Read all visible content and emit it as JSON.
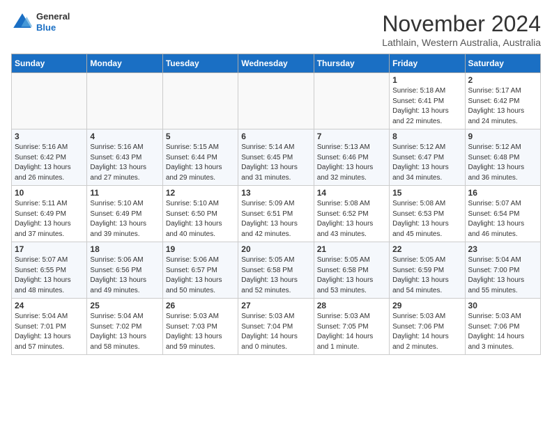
{
  "logo": {
    "general": "General",
    "blue": "Blue"
  },
  "header": {
    "month": "November 2024",
    "location": "Lathlain, Western Australia, Australia"
  },
  "weekdays": [
    "Sunday",
    "Monday",
    "Tuesday",
    "Wednesday",
    "Thursday",
    "Friday",
    "Saturday"
  ],
  "weeks": [
    [
      {
        "day": "",
        "info": ""
      },
      {
        "day": "",
        "info": ""
      },
      {
        "day": "",
        "info": ""
      },
      {
        "day": "",
        "info": ""
      },
      {
        "day": "",
        "info": ""
      },
      {
        "day": "1",
        "info": "Sunrise: 5:18 AM\nSunset: 6:41 PM\nDaylight: 13 hours\nand 22 minutes."
      },
      {
        "day": "2",
        "info": "Sunrise: 5:17 AM\nSunset: 6:42 PM\nDaylight: 13 hours\nand 24 minutes."
      }
    ],
    [
      {
        "day": "3",
        "info": "Sunrise: 5:16 AM\nSunset: 6:42 PM\nDaylight: 13 hours\nand 26 minutes."
      },
      {
        "day": "4",
        "info": "Sunrise: 5:16 AM\nSunset: 6:43 PM\nDaylight: 13 hours\nand 27 minutes."
      },
      {
        "day": "5",
        "info": "Sunrise: 5:15 AM\nSunset: 6:44 PM\nDaylight: 13 hours\nand 29 minutes."
      },
      {
        "day": "6",
        "info": "Sunrise: 5:14 AM\nSunset: 6:45 PM\nDaylight: 13 hours\nand 31 minutes."
      },
      {
        "day": "7",
        "info": "Sunrise: 5:13 AM\nSunset: 6:46 PM\nDaylight: 13 hours\nand 32 minutes."
      },
      {
        "day": "8",
        "info": "Sunrise: 5:12 AM\nSunset: 6:47 PM\nDaylight: 13 hours\nand 34 minutes."
      },
      {
        "day": "9",
        "info": "Sunrise: 5:12 AM\nSunset: 6:48 PM\nDaylight: 13 hours\nand 36 minutes."
      }
    ],
    [
      {
        "day": "10",
        "info": "Sunrise: 5:11 AM\nSunset: 6:49 PM\nDaylight: 13 hours\nand 37 minutes."
      },
      {
        "day": "11",
        "info": "Sunrise: 5:10 AM\nSunset: 6:49 PM\nDaylight: 13 hours\nand 39 minutes."
      },
      {
        "day": "12",
        "info": "Sunrise: 5:10 AM\nSunset: 6:50 PM\nDaylight: 13 hours\nand 40 minutes."
      },
      {
        "day": "13",
        "info": "Sunrise: 5:09 AM\nSunset: 6:51 PM\nDaylight: 13 hours\nand 42 minutes."
      },
      {
        "day": "14",
        "info": "Sunrise: 5:08 AM\nSunset: 6:52 PM\nDaylight: 13 hours\nand 43 minutes."
      },
      {
        "day": "15",
        "info": "Sunrise: 5:08 AM\nSunset: 6:53 PM\nDaylight: 13 hours\nand 45 minutes."
      },
      {
        "day": "16",
        "info": "Sunrise: 5:07 AM\nSunset: 6:54 PM\nDaylight: 13 hours\nand 46 minutes."
      }
    ],
    [
      {
        "day": "17",
        "info": "Sunrise: 5:07 AM\nSunset: 6:55 PM\nDaylight: 13 hours\nand 48 minutes."
      },
      {
        "day": "18",
        "info": "Sunrise: 5:06 AM\nSunset: 6:56 PM\nDaylight: 13 hours\nand 49 minutes."
      },
      {
        "day": "19",
        "info": "Sunrise: 5:06 AM\nSunset: 6:57 PM\nDaylight: 13 hours\nand 50 minutes."
      },
      {
        "day": "20",
        "info": "Sunrise: 5:05 AM\nSunset: 6:58 PM\nDaylight: 13 hours\nand 52 minutes."
      },
      {
        "day": "21",
        "info": "Sunrise: 5:05 AM\nSunset: 6:58 PM\nDaylight: 13 hours\nand 53 minutes."
      },
      {
        "day": "22",
        "info": "Sunrise: 5:05 AM\nSunset: 6:59 PM\nDaylight: 13 hours\nand 54 minutes."
      },
      {
        "day": "23",
        "info": "Sunrise: 5:04 AM\nSunset: 7:00 PM\nDaylight: 13 hours\nand 55 minutes."
      }
    ],
    [
      {
        "day": "24",
        "info": "Sunrise: 5:04 AM\nSunset: 7:01 PM\nDaylight: 13 hours\nand 57 minutes."
      },
      {
        "day": "25",
        "info": "Sunrise: 5:04 AM\nSunset: 7:02 PM\nDaylight: 13 hours\nand 58 minutes."
      },
      {
        "day": "26",
        "info": "Sunrise: 5:03 AM\nSunset: 7:03 PM\nDaylight: 13 hours\nand 59 minutes."
      },
      {
        "day": "27",
        "info": "Sunrise: 5:03 AM\nSunset: 7:04 PM\nDaylight: 14 hours\nand 0 minutes."
      },
      {
        "day": "28",
        "info": "Sunrise: 5:03 AM\nSunset: 7:05 PM\nDaylight: 14 hours\nand 1 minute."
      },
      {
        "day": "29",
        "info": "Sunrise: 5:03 AM\nSunset: 7:06 PM\nDaylight: 14 hours\nand 2 minutes."
      },
      {
        "day": "30",
        "info": "Sunrise: 5:03 AM\nSunset: 7:06 PM\nDaylight: 14 hours\nand 3 minutes."
      }
    ]
  ]
}
